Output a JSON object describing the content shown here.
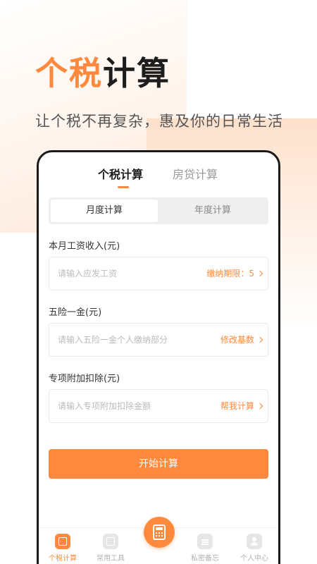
{
  "hero": {
    "title_accent": "个税",
    "title_rest": "计算",
    "subtitle": "让个税不再复杂，惠及你的日常生活"
  },
  "tabs": [
    {
      "label": "个税计算",
      "active": true
    },
    {
      "label": "房贷计算",
      "active": false
    }
  ],
  "segment": {
    "monthly": "月度计算",
    "yearly": "年度计算"
  },
  "fields": {
    "salary": {
      "label": "本月工资收入(元)",
      "placeholder": "请输入应发工资",
      "action": "缴纳期限：5"
    },
    "insurance": {
      "label": "五险一金(元)",
      "placeholder": "请输入五险一金个人缴纳部分",
      "action": "修改基数"
    },
    "deduction": {
      "label": "专项附加扣除(元)",
      "placeholder": "请输入专项附加扣除金额",
      "action": "帮我计算"
    }
  },
  "primary_button": "开始计算",
  "bottom_nav": {
    "items": [
      {
        "label": "个税计算",
        "icon": "tax-icon",
        "active": true
      },
      {
        "label": "常用工具",
        "icon": "tools-icon",
        "active": false
      },
      {
        "label": "私密备忘",
        "icon": "memo-icon",
        "active": false
      },
      {
        "label": "个人中心",
        "icon": "user-icon",
        "active": false
      }
    ],
    "center_icon": "calculator-icon"
  },
  "colors": {
    "accent": "#ff8a3d",
    "text_dark": "#1d1d1d",
    "text_muted": "#999999"
  }
}
